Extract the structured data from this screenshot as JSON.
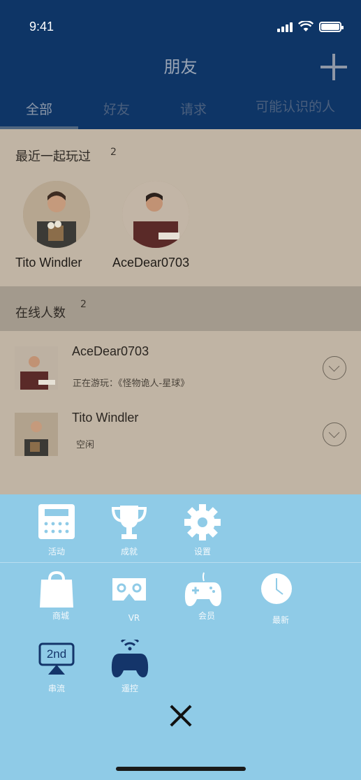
{
  "status_bar": {
    "time": "9:41"
  },
  "header": {
    "title": "朋友"
  },
  "tabs": [
    {
      "label": "全部",
      "active": true
    },
    {
      "label": "好友",
      "active": false
    },
    {
      "label": "请求",
      "active": false
    },
    {
      "label": "可能认识的人",
      "active": false
    }
  ],
  "recent": {
    "heading": "最近一起玩过",
    "count": "2",
    "people": [
      {
        "name": "Tito Windler"
      },
      {
        "name": "AceDear0703"
      }
    ]
  },
  "online": {
    "heading": "在线人数",
    "count": "2",
    "rows": [
      {
        "name": "AceDear0703",
        "status": "正在游玩：《怪物诡人-星球》"
      },
      {
        "name": "Tito Windler",
        "status": "空闲"
      }
    ]
  },
  "menu": {
    "items": [
      {
        "label": "活动",
        "icon": "calculator-icon"
      },
      {
        "label": "成就",
        "icon": "trophy-icon"
      },
      {
        "label": "设置",
        "icon": "gear-icon"
      },
      {
        "label": "商城",
        "icon": "shopping-bag-icon"
      },
      {
        "label": "VR",
        "icon": "vr-headset-icon"
      },
      {
        "label": "会员",
        "icon": "gamepad-icon"
      },
      {
        "label": "最新",
        "icon": "clock-icon"
      },
      {
        "label": "串流",
        "icon": "second-screen-icon",
        "icon_text": "2nd"
      },
      {
        "label": "遥控",
        "icon": "wireless-controller-icon"
      }
    ]
  },
  "colors": {
    "header_bg": "#0e3566",
    "sheet_bg": "#8fcbe7",
    "overlay_content": "#c0b4a4"
  }
}
